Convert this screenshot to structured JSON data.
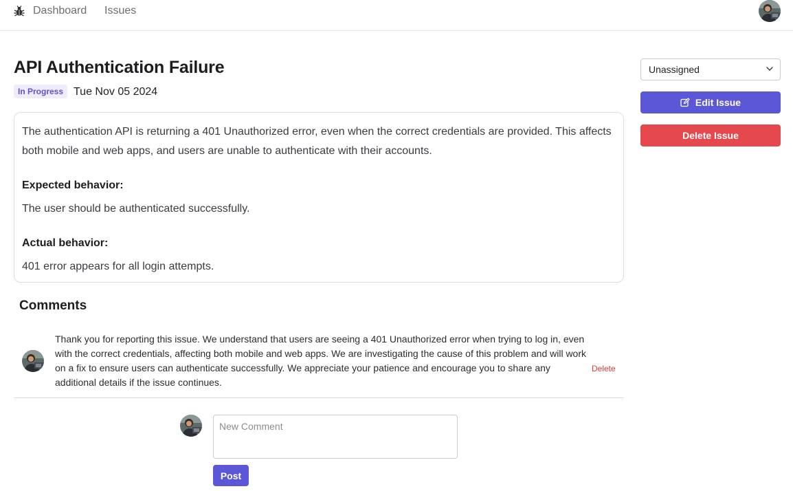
{
  "nav": {
    "logo_icon": "bug-icon",
    "dashboard_label": "Dashboard",
    "issues_label": "Issues"
  },
  "issue": {
    "title": "API Authentication Failure",
    "status": "In Progress",
    "date": "Tue Nov 05 2024",
    "description": {
      "intro": "The authentication API is returning a 401 Unauthorized error, even when the correct credentials are provided. This affects both mobile and web apps, and users are unable to authenticate with their accounts.",
      "expected_heading": "Expected behavior:",
      "expected_text": "The user should be authenticated successfully.",
      "actual_heading": "Actual behavior:",
      "actual_text": "401 error appears for all login attempts."
    }
  },
  "comments": {
    "title": "Comments",
    "items": [
      {
        "text": "Thank you for reporting this issue. We understand that users are seeing a 401 Unauthorized error when trying to log in, even with the correct credentials, affecting both mobile and web apps. We are investigating the cause of this problem and will work on a fix to ensure users can authenticate successfully. We appreciate your patience and encourage you to share any additional details if the issue continues.",
        "delete_label": "Delete"
      }
    ],
    "new_comment_placeholder": "New Comment",
    "post_label": "Post"
  },
  "sidebar": {
    "assignee_value": "Unassigned",
    "edit_label": "Edit Issue",
    "edit_icon": "edit-icon",
    "delete_label": "Delete Issue"
  },
  "colors": {
    "primary": "#5b57d6",
    "danger": "#e5484d",
    "status_bg": "#f0ecfb",
    "status_text": "#6a4fc4"
  }
}
